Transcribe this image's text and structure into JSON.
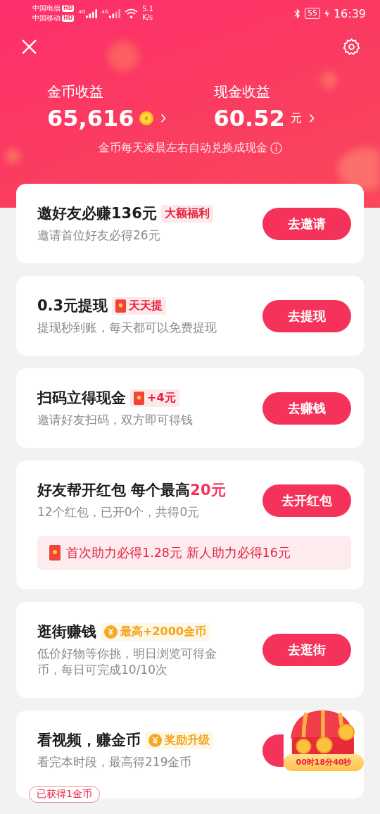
{
  "status_bar": {
    "carriers": [
      {
        "name": "中国电信",
        "tag": "HD"
      },
      {
        "name": "中国移动",
        "tag": "HD"
      }
    ],
    "networks": [
      "4G",
      "4G"
    ],
    "speed": "5.1",
    "speed_unit": "K/s",
    "battery": "55",
    "time": "16:39"
  },
  "header": {
    "earnings": [
      {
        "label": "金币收益",
        "value": "65,616",
        "coin_icon": true
      },
      {
        "label": "现金收益",
        "value": "60.52",
        "unit": "元"
      }
    ],
    "note": "金币每天凌晨左右自动兑换成现金"
  },
  "tasks": [
    {
      "title": "邀好友必赚136元",
      "badge": {
        "kind": "plain",
        "text": "大额福利"
      },
      "subtitle": "邀请首位好友必得26元",
      "button": "去邀请"
    },
    {
      "title": "0.3元提现",
      "badge": {
        "kind": "envelope",
        "text": "天天提"
      },
      "subtitle": "提现秒到账，每天都可以免费提现",
      "button": "去提现"
    },
    {
      "title": "扫码立得现金",
      "badge": {
        "kind": "envelope",
        "text": "+4元"
      },
      "subtitle": "邀请好友扫码，双方即可得钱",
      "button": "去赚钱"
    },
    {
      "title": "好友帮开红包 每个最高",
      "title_highlight": "20元",
      "subtitle": "12个红包，已开0个，共得0元",
      "button": "去开红包",
      "tip": "首次助力必得1.28元 新人助力必得16元"
    },
    {
      "title": "逛街赚钱",
      "badge": {
        "kind": "coin",
        "text": "最高+2000金币"
      },
      "subtitle": "低价好物等你挑，明日浏览可得金币，每日可完成10/10次",
      "button": "去逛街"
    },
    {
      "title": "看视频，赚金币",
      "badge": {
        "kind": "coin",
        "text": "奖励升级"
      },
      "subtitle": "看完本时段，最高得219金币",
      "chest": {
        "countdown": "00时18分40秒"
      },
      "earned": "已获得1金币"
    }
  ]
}
